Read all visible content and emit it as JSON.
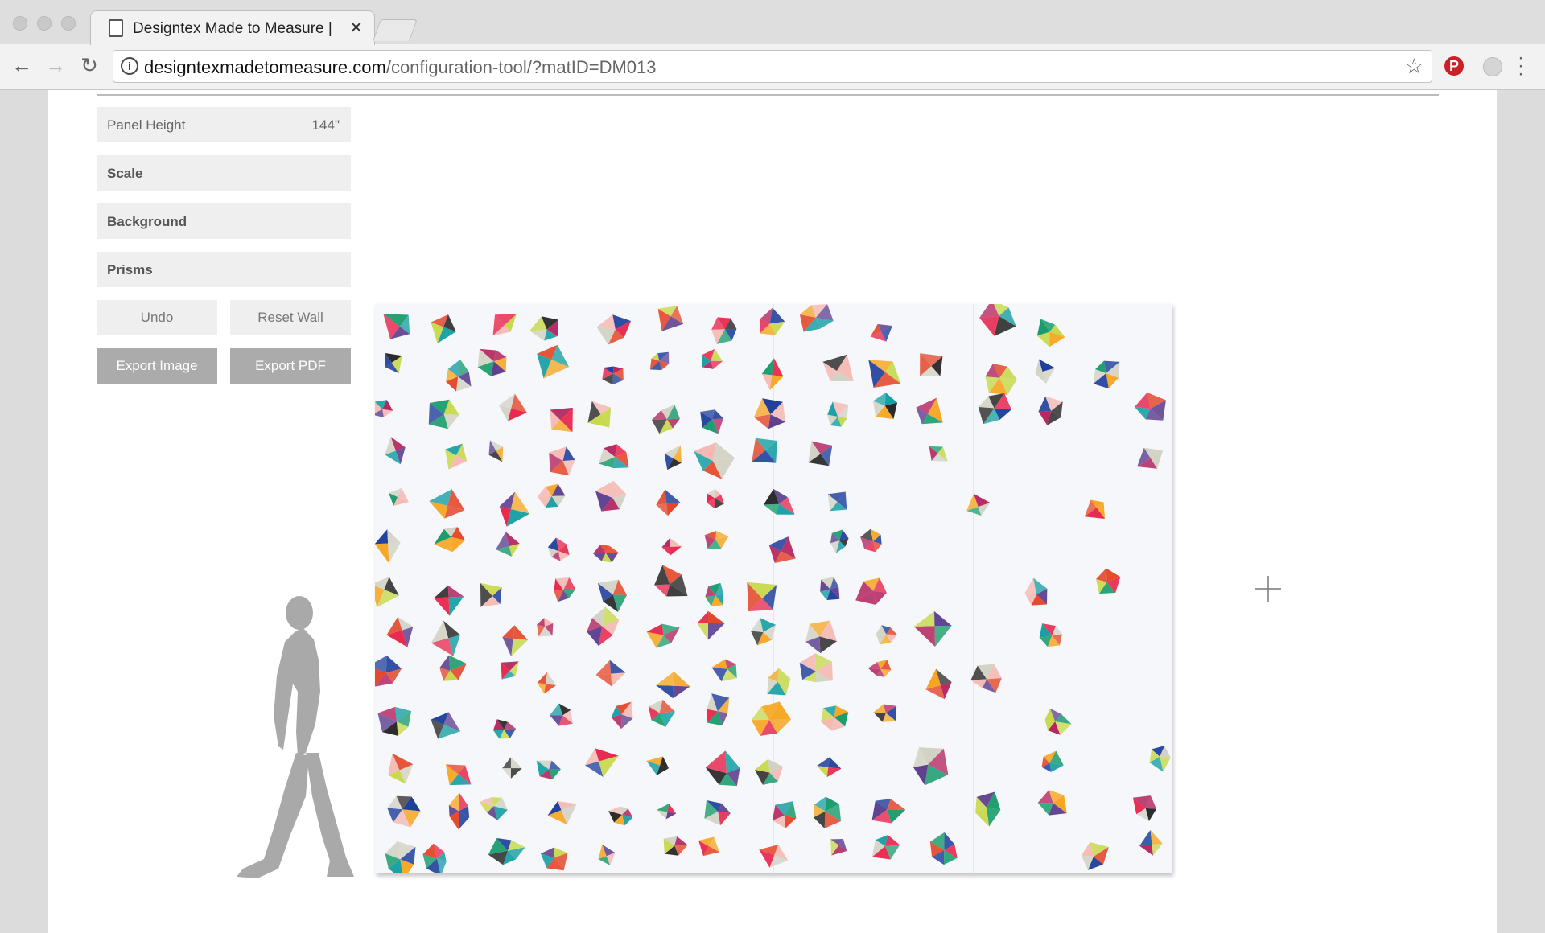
{
  "browser": {
    "tab_title": "Designtex Made to Measure | ",
    "url_host": "designtexmadetomeasure.com",
    "url_path": "/configuration-tool/?matID=DM013"
  },
  "sidebar": {
    "panel_height_label": "Panel Height",
    "panel_height_value": "144\"",
    "sections": [
      "Scale",
      "Background",
      "Prisms"
    ],
    "undo_label": "Undo",
    "reset_label": "Reset Wall",
    "export_image_label": "Export Image",
    "export_pdf_label": "Export PDF"
  },
  "wall": {
    "panel_count": 4,
    "palette": [
      "#e8274d",
      "#1f3f9c",
      "#f6a623",
      "#1a9c6c",
      "#c7d84a",
      "#b3235e",
      "#2b2b2b",
      "#f5b7b0",
      "#5d3f8f",
      "#d2d2c4",
      "#19a0a5",
      "#e4472a"
    ]
  }
}
